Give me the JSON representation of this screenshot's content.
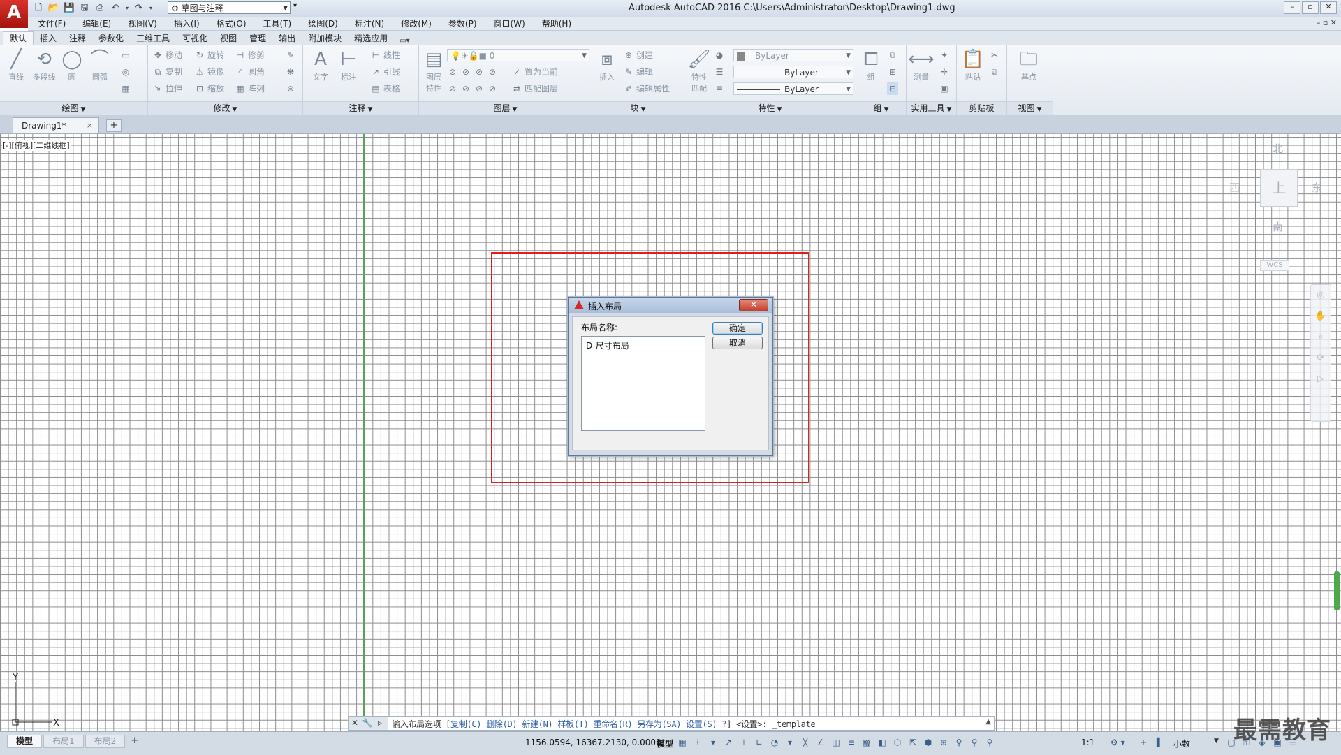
{
  "app": {
    "logo": "A",
    "title": "Autodesk AutoCAD 2016    C:\\Users\\Administrator\\Desktop\\Drawing1.dwg",
    "workspace": "草图与注释"
  },
  "menu": [
    "文件(F)",
    "编辑(E)",
    "视图(V)",
    "插入(I)",
    "格式(O)",
    "工具(T)",
    "绘图(D)",
    "标注(N)",
    "修改(M)",
    "参数(P)",
    "窗口(W)",
    "帮助(H)"
  ],
  "ribbon_tabs": [
    "默认",
    "插入",
    "注释",
    "参数化",
    "三维工具",
    "可视化",
    "视图",
    "管理",
    "输出",
    "附加模块",
    "精选应用"
  ],
  "ribbon": {
    "draw": {
      "title": "绘图",
      "line": "直线",
      "polyline": "多段线",
      "circle": "圆",
      "arc": "圆弧"
    },
    "modify": {
      "title": "修改",
      "move": "移动",
      "rotate": "旋转",
      "trim": "修剪",
      "copy": "复制",
      "mirror": "镜像",
      "fillet": "圆角",
      "stretch": "拉伸",
      "scale": "缩放",
      "array": "阵列"
    },
    "annotation": {
      "title": "注释",
      "text": "文字",
      "dimension": "标注",
      "linear": "线性",
      "leader": "引线",
      "table": "表格"
    },
    "layers": {
      "title": "图层",
      "layer_props": "图层\n特性",
      "layer_value": "0",
      "set_current": "置为当前",
      "match_layer": "匹配图层"
    },
    "block": {
      "title": "块",
      "insert": "插入",
      "create": "创建",
      "edit": "编辑",
      "edit_attr": "编辑属性"
    },
    "properties": {
      "title": "特性",
      "match": "特性\n匹配",
      "color": "ByLayer",
      "linetype": "ByLayer",
      "lineweight": "ByLayer"
    },
    "groups": {
      "title": "组",
      "group": "组"
    },
    "utilities": {
      "title": "实用工具",
      "measure": "测量"
    },
    "clipboard": {
      "title": "剪贴板",
      "paste": "粘贴"
    },
    "view": {
      "title": "视图",
      "base": "基点"
    }
  },
  "doc_tab": {
    "name": "Drawing1*",
    "close": "×",
    "add": "+"
  },
  "viewport_label": "[-][俯视][二维线框]",
  "viewcube": {
    "north": "北",
    "south": "南",
    "east": "东",
    "west": "西",
    "top": "上",
    "wcs": "WCS"
  },
  "dialog": {
    "title": "插入布局",
    "close": "✕",
    "label": "布局名称:",
    "items": [
      "D-尺寸布局"
    ],
    "ok": "确定",
    "cancel": "取消"
  },
  "command_line": {
    "prefix": "输入布局选项 [",
    "options": [
      "复制(C)",
      "删除(D)",
      "新建(N)",
      "样板(T)",
      "重命名(R)",
      "另存为(SA)",
      "设置(S)",
      "?"
    ],
    "suffix": "] <设置>: _template"
  },
  "layout_tabs": [
    "模型",
    "布局1",
    "布局2"
  ],
  "status": {
    "coords": "1156.0594, 16367.2130, 0.0000",
    "model": "模型",
    "scale": "1:1",
    "units": "小数"
  },
  "watermark": "最需教育",
  "colors": {
    "accent_red": "#e01e1e",
    "axis_green": "#5aa05a",
    "logo_red": "#d8342c"
  }
}
